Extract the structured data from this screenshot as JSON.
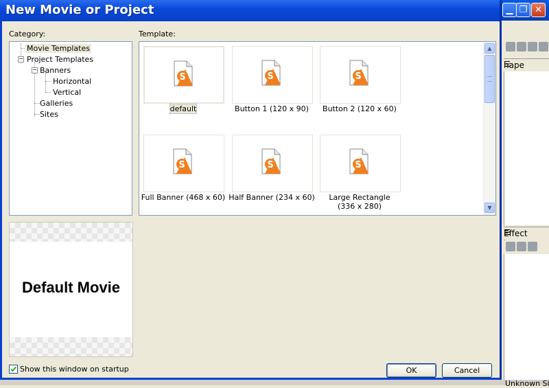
{
  "dialog": {
    "title": "New Movie or Project",
    "category_label": "Category:",
    "template_label": "Template:",
    "tree": [
      {
        "label": "Movie Templates",
        "selected": true
      },
      {
        "label": "Project Templates"
      },
      {
        "label": "Banners"
      },
      {
        "label": "Horizontal"
      },
      {
        "label": "Vertical"
      },
      {
        "label": "Galleries"
      },
      {
        "label": "Sites"
      }
    ],
    "templates": [
      {
        "label": "default",
        "selected": true
      },
      {
        "label": "Button 1 (120 x 90)"
      },
      {
        "label": "Button 2 (120 x 60)"
      },
      {
        "label": "Full Banner (468 x 60)"
      },
      {
        "label": "Half Banner (234 x 60)"
      },
      {
        "label": "Large Rectangle (336 x 280)"
      }
    ],
    "preview_text": "Default Movie",
    "startup_checkbox": {
      "label": "Show this window on startup",
      "checked": true
    },
    "ok_label": "OK",
    "cancel_label": "Cancel"
  },
  "background": {
    "tab1": "hape",
    "tab2": "Effect",
    "status_text": "Unknown Size"
  },
  "colors": {
    "titlebar": "#0a4ad8",
    "accent_icon": "#f07f1e",
    "dialog_bg": "#ece9d8"
  }
}
